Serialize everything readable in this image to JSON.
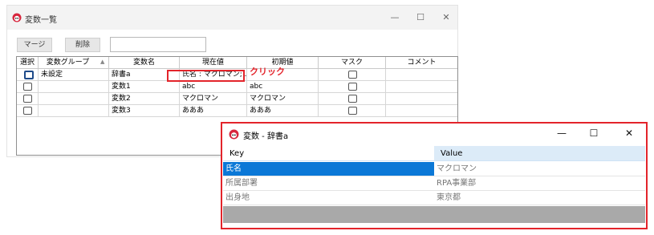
{
  "main_window": {
    "title": "変数一覧",
    "controls": {
      "minimize": "—",
      "maximize": "☐",
      "close": "✕"
    },
    "buttons": {
      "merge": "マージ",
      "delete": "削除"
    },
    "search_value": "",
    "columns": [
      "選択",
      "変数グループ",
      "変数名",
      "現在値",
      "初期値",
      "マスク",
      "コメント"
    ],
    "sort_indicator": "▲",
    "rows": [
      {
        "selected": true,
        "group": "未設定",
        "name": "辞書a",
        "current": "氏名 : マクロマン; ...",
        "initial": "",
        "mask": false,
        "comment": ""
      },
      {
        "selected": false,
        "group": "",
        "name": "変数1",
        "current": "abc",
        "initial": "abc",
        "mask": false,
        "comment": ""
      },
      {
        "selected": false,
        "group": "",
        "name": "変数2",
        "current": "マクロマン",
        "initial": "マクロマン",
        "mask": false,
        "comment": ""
      },
      {
        "selected": false,
        "group": "",
        "name": "変数3",
        "current": "あああ",
        "initial": "あああ",
        "mask": false,
        "comment": ""
      }
    ]
  },
  "annotation": {
    "click_label": "クリック",
    "accent_color": "#e3242b"
  },
  "popup_window": {
    "title": "変数 - 辞書a",
    "controls": {
      "minimize": "—",
      "maximize": "☐",
      "close": "✕"
    },
    "columns": {
      "key": "Key",
      "value": "Value"
    },
    "rows": [
      {
        "key": "氏名",
        "value": "マクロマン"
      },
      {
        "key": "所属部署",
        "value": "RPA事業部"
      },
      {
        "key": "出身地",
        "value": "東京都"
      }
    ],
    "selected_color": "#0b78d7"
  },
  "icons": {
    "app": "app-icon"
  }
}
